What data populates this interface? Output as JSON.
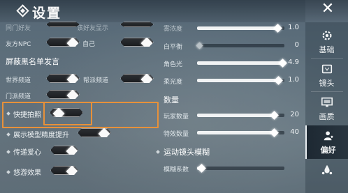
{
  "window": {
    "title": "设置",
    "close_glyph": "✕"
  },
  "left": {
    "cut_top_labels": [
      "同门好友",
      "该好友显示"
    ],
    "friend_npc_label": "友方NPC",
    "self_label": "自己",
    "block_section": "屏蔽黑名单发言",
    "world_channel": "世界频道",
    "guild_channel": "帮派频道",
    "sect_channel": "门派频道",
    "quick_photo": "快捷拍照",
    "show_model": "展示模型精度提升",
    "love_transfer": "传递爱心",
    "travel_effect": "悠游效果"
  },
  "right": {
    "cut_top": {
      "label": "雾浓度",
      "value": "1.0",
      "level": 0.92
    },
    "white_balance": {
      "label": "白平衡",
      "value": "0",
      "level": 0.0
    },
    "saturation": {
      "label": "角色光",
      "value": "4.9",
      "level": 0.97
    },
    "softness": {
      "label": "柔光度",
      "value": "1.0",
      "level": 0.93
    },
    "quantity_section": "数量",
    "player_count": {
      "label": "玩家数量",
      "value": "20",
      "level": 0.88
    },
    "effect_count": {
      "label": "特效数量",
      "value": "40",
      "level": 0.88
    },
    "motion_blur_section": "运动镜头模糊",
    "blur_coefficient": {
      "label": "模糊系数",
      "value": "",
      "level": 0.0
    }
  },
  "tabs": [
    {
      "label": "基础",
      "icon": "gear-icon"
    },
    {
      "label": "镜头",
      "icon": "camera-frame-icon"
    },
    {
      "label": "画质",
      "icon": "monitor-icon"
    },
    {
      "label": "偏好",
      "icon": "person-icon",
      "active": true
    },
    {
      "label": "",
      "icon": "drops-icon"
    }
  ]
}
